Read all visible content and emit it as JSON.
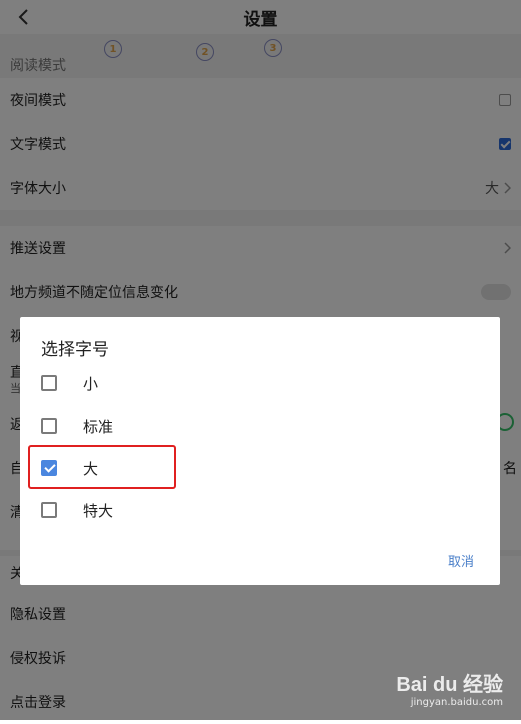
{
  "header": {
    "title": "设置"
  },
  "steps": [
    "1",
    "2",
    "3"
  ],
  "reading": {
    "section_label": "阅读模式",
    "night_mode": "夜间模式",
    "text_mode": "文字模式",
    "font_size": "字体大小",
    "font_size_value": "大"
  },
  "push": {
    "push_settings": "推送设置",
    "local_channel": "地方频道不随定位信息变化"
  },
  "partial_rows": {
    "video": "视",
    "direct": "直",
    "direct_sub": "当",
    "back": "返",
    "auto": "自",
    "auto_right": "名",
    "clear": "清",
    "about": "关"
  },
  "bottom": {
    "privacy": "隐私设置",
    "infringement": "侵权投诉",
    "login": "点击登录"
  },
  "dialog": {
    "title": "选择字号",
    "options": [
      {
        "label": "小",
        "checked": false
      },
      {
        "label": "标准",
        "checked": false
      },
      {
        "label": "大",
        "checked": true
      },
      {
        "label": "特大",
        "checked": false
      }
    ],
    "cancel": "取消"
  },
  "watermark": {
    "logo": "Bai du 经验",
    "url": "jingyan.baidu.com"
  },
  "colors": {
    "accent": "#4a86df",
    "highlight": "#e02020",
    "toggle_on": "#36c26a"
  }
}
